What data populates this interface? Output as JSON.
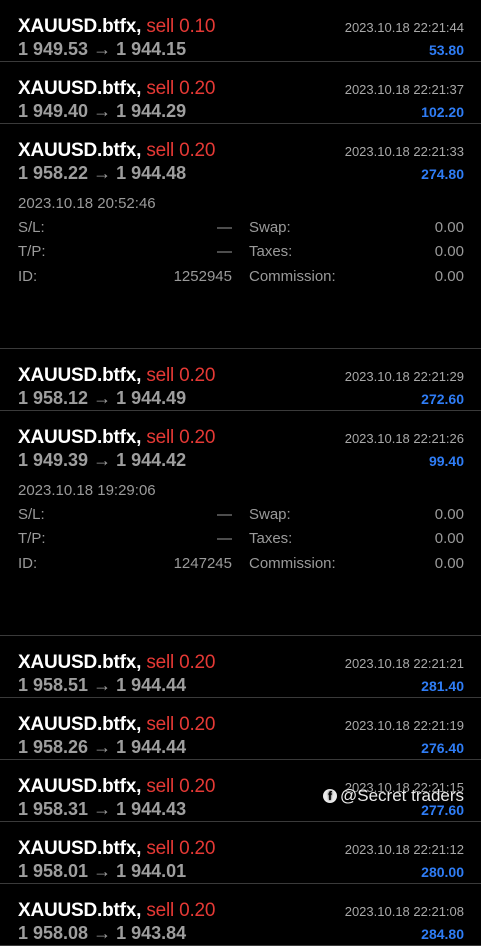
{
  "trades": [
    {
      "symbol": "XAUUSD.btfx,",
      "side": "sell 0.10",
      "open_price": "1 949.53",
      "close_price": "1 944.15",
      "close_time": "2023.10.18 22:21:44",
      "profit": "53.80",
      "expanded": false
    },
    {
      "symbol": "XAUUSD.btfx,",
      "side": "sell 0.20",
      "open_price": "1 949.40",
      "close_price": "1 944.29",
      "close_time": "2023.10.18 22:21:37",
      "profit": "102.20",
      "expanded": false
    },
    {
      "symbol": "XAUUSD.btfx,",
      "side": "sell 0.20",
      "open_price": "1 958.22",
      "close_price": "1 944.48",
      "close_time": "2023.10.18 22:21:33",
      "profit": "274.80",
      "expanded": true,
      "details": {
        "open_time": "2023.10.18 20:52:46",
        "sl_label": "S/L:",
        "sl": "—",
        "tp_label": "T/P:",
        "tp": "—",
        "id_label": "ID:",
        "id": "1252945",
        "swap_label": "Swap:",
        "swap": "0.00",
        "taxes_label": "Taxes:",
        "taxes": "0.00",
        "commission_label": "Commission:",
        "commission": "0.00"
      }
    },
    {
      "symbol": "XAUUSD.btfx,",
      "side": "sell 0.20",
      "open_price": "1 958.12",
      "close_price": "1 944.49",
      "close_time": "2023.10.18 22:21:29",
      "profit": "272.60",
      "expanded": false
    },
    {
      "symbol": "XAUUSD.btfx,",
      "side": "sell 0.20",
      "open_price": "1 949.39",
      "close_price": "1 944.42",
      "close_time": "2023.10.18 22:21:26",
      "profit": "99.40",
      "expanded": true,
      "details": {
        "open_time": "2023.10.18 19:29:06",
        "sl_label": "S/L:",
        "sl": "—",
        "tp_label": "T/P:",
        "tp": "—",
        "id_label": "ID:",
        "id": "1247245",
        "swap_label": "Swap:",
        "swap": "0.00",
        "taxes_label": "Taxes:",
        "taxes": "0.00",
        "commission_label": "Commission:",
        "commission": "0.00"
      }
    },
    {
      "symbol": "XAUUSD.btfx,",
      "side": "sell 0.20",
      "open_price": "1 958.51",
      "close_price": "1 944.44",
      "close_time": "2023.10.18 22:21:21",
      "profit": "281.40",
      "expanded": false
    },
    {
      "symbol": "XAUUSD.btfx,",
      "side": "sell 0.20",
      "open_price": "1 958.26",
      "close_price": "1 944.44",
      "close_time": "2023.10.18 22:21:19",
      "profit": "276.40",
      "expanded": false
    },
    {
      "symbol": "XAUUSD.btfx,",
      "side": "sell 0.20",
      "open_price": "1 958.31",
      "close_price": "1 944.43",
      "close_time": "2023.10.18 22:21:15",
      "profit": "277.60",
      "expanded": false
    },
    {
      "symbol": "XAUUSD.btfx,",
      "side": "sell 0.20",
      "open_price": "1 958.01",
      "close_price": "1 944.01",
      "close_time": "2023.10.18 22:21:12",
      "profit": "280.00",
      "expanded": false
    },
    {
      "symbol": "XAUUSD.btfx,",
      "side": "sell 0.20",
      "open_price": "1 958.08",
      "close_price": "1 943.84",
      "close_time": "2023.10.18 22:21:08",
      "profit": "284.80",
      "expanded": false
    }
  ],
  "arrow": "→",
  "watermark": {
    "text": "@Secret traders",
    "icon": "facebook-icon"
  },
  "colors": {
    "sell": "#e53935",
    "profit": "#2f7df6",
    "price": "#9e9e9e",
    "background": "#000000"
  }
}
